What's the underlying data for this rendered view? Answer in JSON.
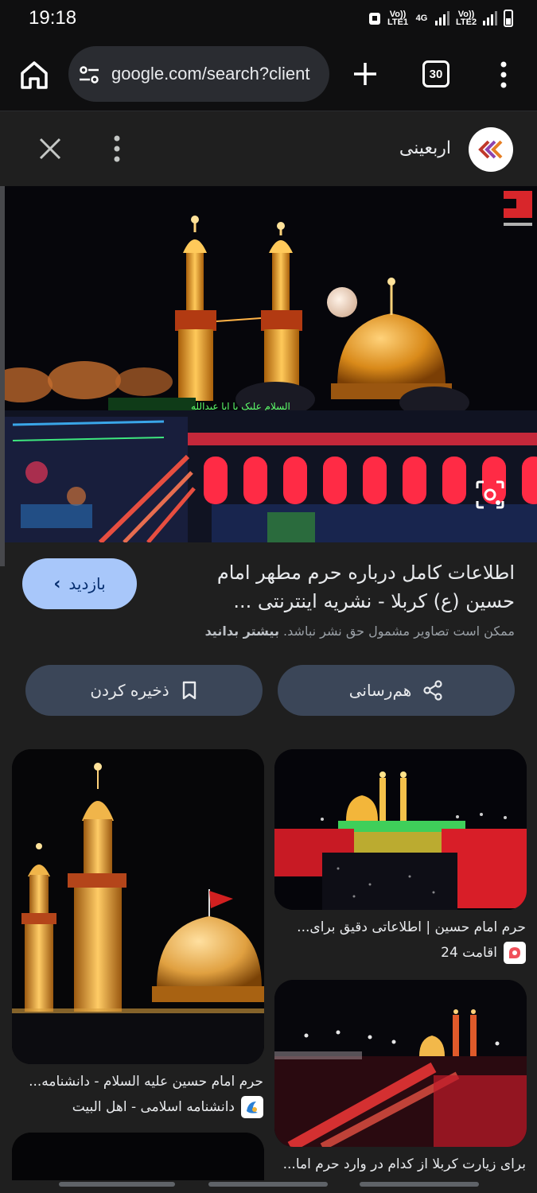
{
  "status_bar": {
    "time": "19:18",
    "net1": "Vo)) LTE1",
    "net2": "4G",
    "net3": "Vo)) LTE2"
  },
  "toolbar": {
    "url": "google.com/search?client",
    "tab_count": "30"
  },
  "viewer": {
    "source_name": "اربعینی",
    "title": "اطلاعات کامل درباره حرم مطهر امام حسین (ع) کربلا - نشریه اینترنتی ...",
    "visit_label": "بازدید",
    "copyright_text": "ممکن است تصاویر مشمول حق نشر نباشد.",
    "learn_more": "بیشتر بدانید",
    "share_label": "هم‌رسانی",
    "save_label": "ذخیره کردن",
    "banner_text": "السلام علیک یا ابا عبدالله"
  },
  "related": [
    {
      "caption": "حرم امام حسین | اطلاعاتی دقیق برای...",
      "source": "اقامت 24"
    },
    {
      "caption": "حرم امام حسین علیه السلام - دانشنامه...",
      "source": "دانشنامه اسلامی - اهل البیت"
    },
    {
      "caption": "برای زیارت کربلا از کدام در وارد حرم اما...",
      "source": ""
    }
  ],
  "colors": {
    "accent": "#a8c7fa",
    "chip": "#3b4658",
    "background": "#1f1f1f"
  }
}
